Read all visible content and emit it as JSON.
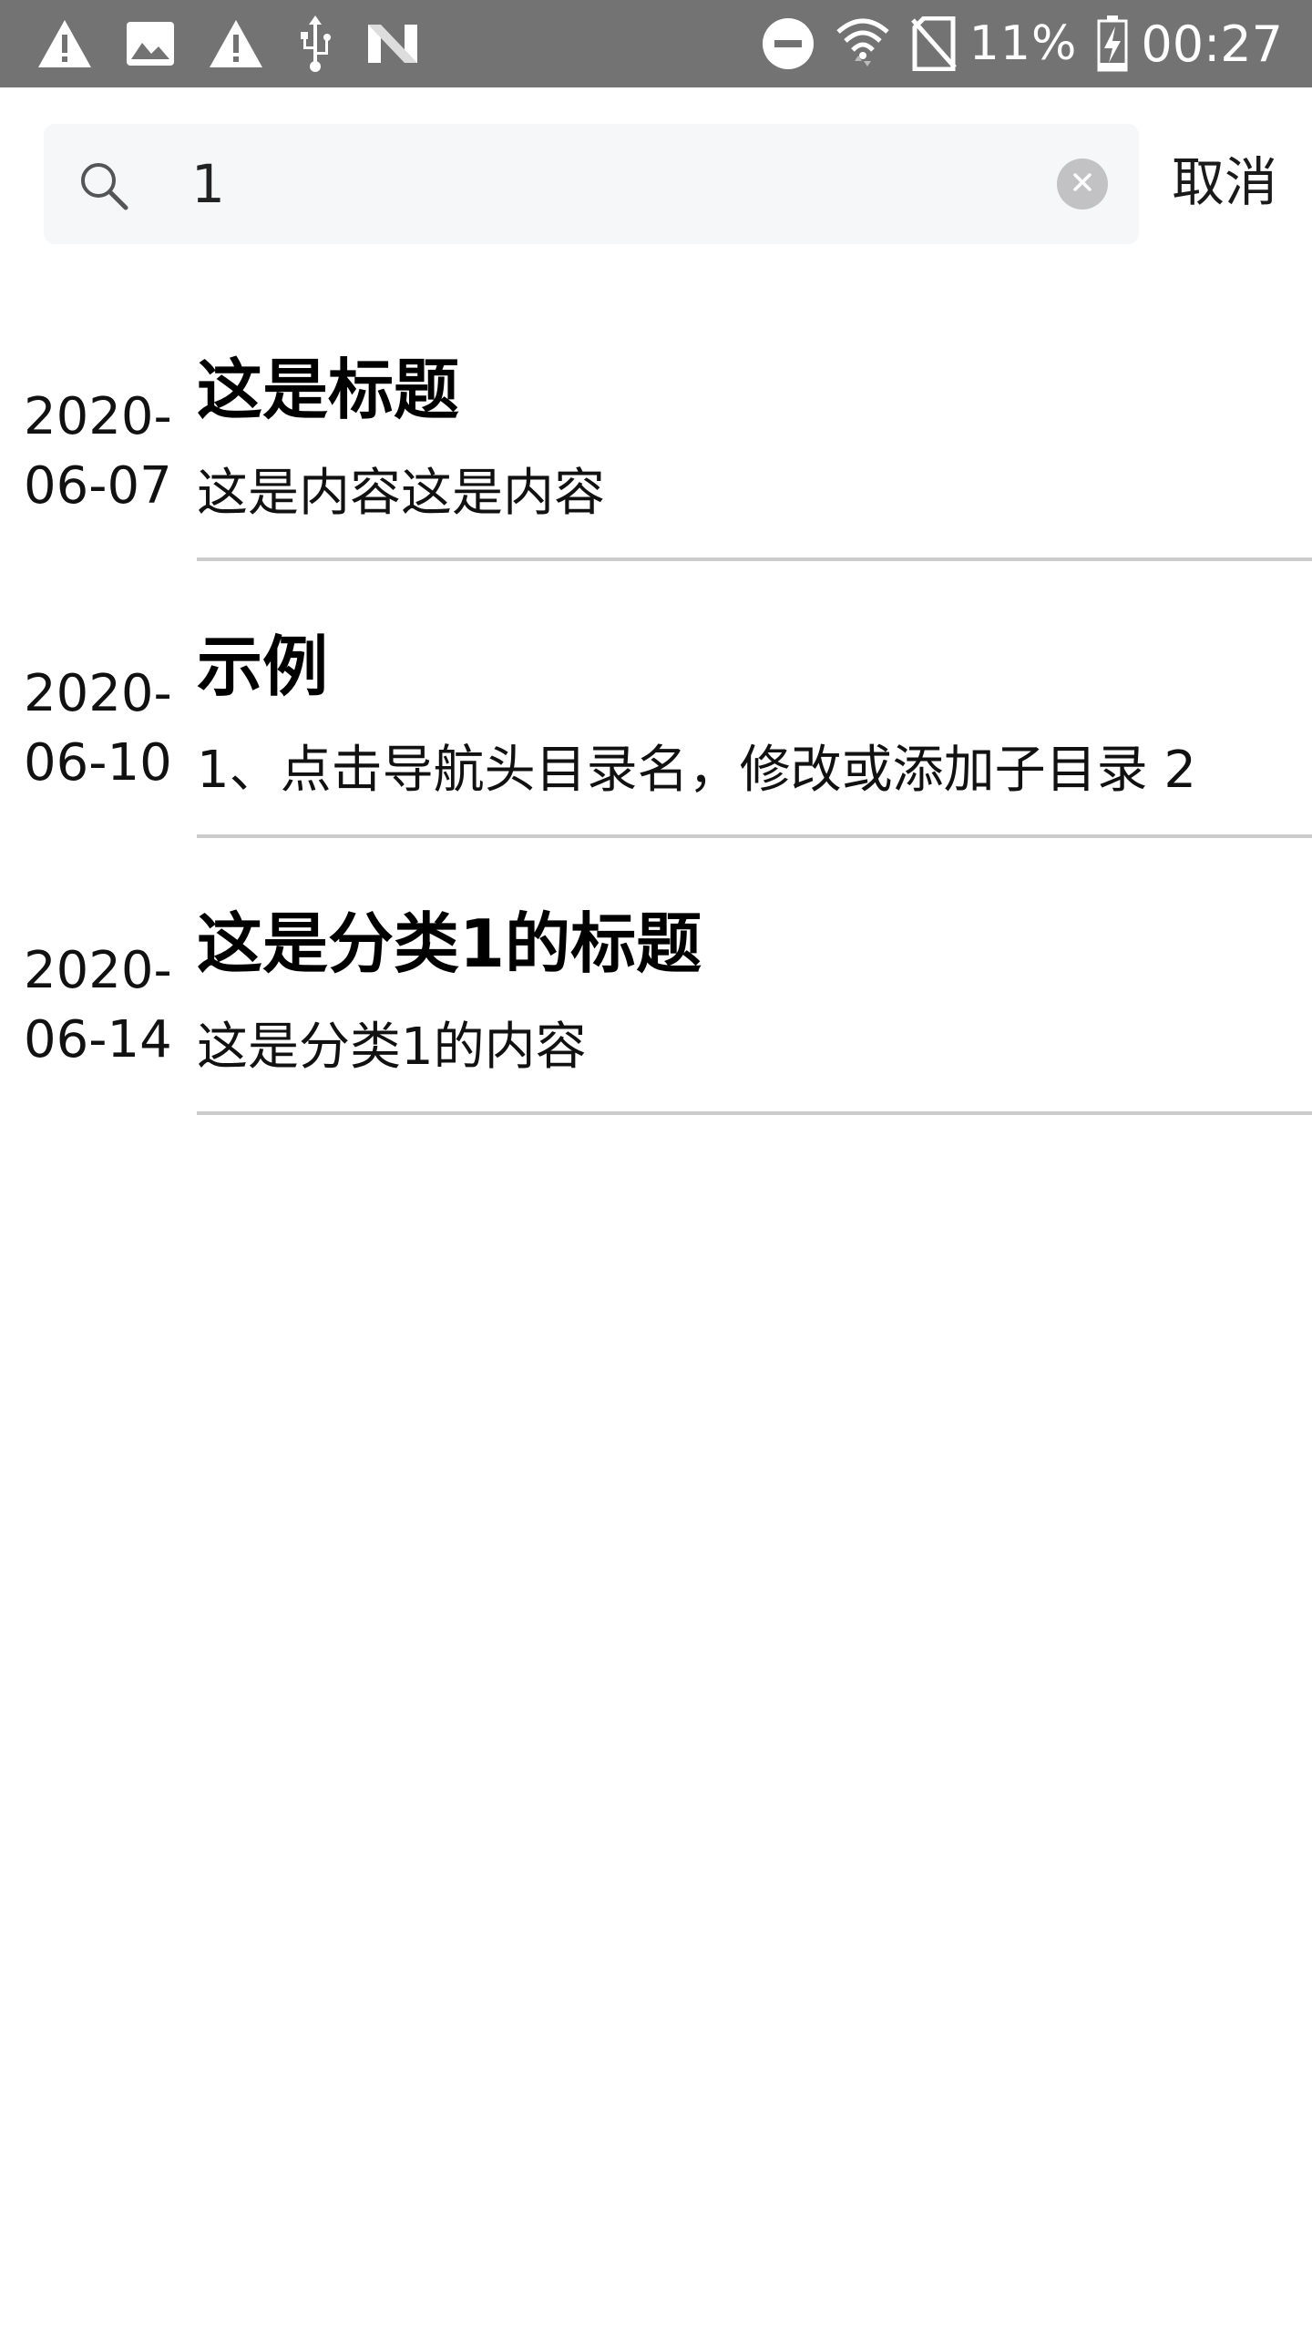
{
  "status_bar": {
    "left_icons": [
      "warning-icon",
      "image-icon",
      "warning-icon",
      "usb-icon",
      "n-logo-icon"
    ],
    "right_icons": [
      "do-not-disturb-icon",
      "wifi-icon",
      "no-sim-icon",
      "battery-charging-icon"
    ],
    "battery_percent": "11%",
    "time": "00:27"
  },
  "search": {
    "value": "1",
    "cancel_label": "取消"
  },
  "results": [
    {
      "date_line1": "2020-",
      "date_line2": "06-07",
      "title": "这是标题",
      "snippet": "这是内容这是内容"
    },
    {
      "date_line1": "2020-",
      "date_line2": "06-10",
      "title": "示例",
      "snippet": "1、点击导航头目录名，修改或添加子目录 2"
    },
    {
      "date_line1": "2020-",
      "date_line2": "06-14",
      "title": "这是分类1的标题",
      "snippet": "这是分类1的内容"
    }
  ],
  "colors": {
    "status_bar_bg": "#737373",
    "search_bg": "#f6f7f9",
    "divider": "#cccccc",
    "clear_button": "#c2c2c4"
  }
}
